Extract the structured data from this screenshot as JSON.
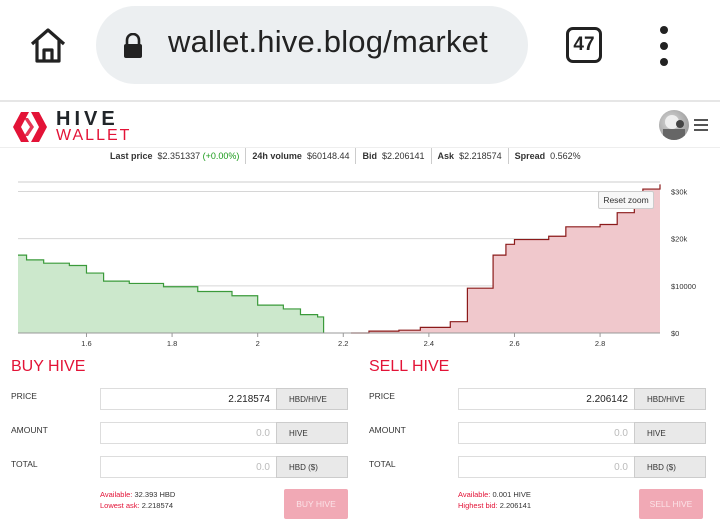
{
  "browser": {
    "url": "wallet.hive.blog/market",
    "tab_count": "47",
    "icons": {
      "home": "home-icon",
      "lock": "lock-icon",
      "menu": "kebab-menu-icon"
    }
  },
  "site": {
    "brand_top": "HIVE",
    "brand_bottom": "WALLET",
    "accent_color": "#e31337"
  },
  "ticker": {
    "last_price_label": "Last price",
    "last_price_value": "$2.351337",
    "last_price_change": "(+0.00%)",
    "volume_label": "24h volume",
    "volume_value": "$60148.44",
    "bid_label": "Bid",
    "bid_value": "$2.206141",
    "ask_label": "Ask",
    "ask_value": "$2.218574",
    "spread_label": "Spread",
    "spread_value": "0.562%"
  },
  "chart_data": {
    "type": "area",
    "reset_zoom_label": "Reset zoom",
    "xlim": [
      1.44,
      2.94
    ],
    "ylim": [
      0,
      32000
    ],
    "x_ticks": [
      "1.6",
      "1.8",
      "2",
      "2.2",
      "2.4",
      "2.6",
      "2.8"
    ],
    "y_ticks": [
      "$0",
      "$10000",
      "$20k",
      "$30k"
    ],
    "grid": true,
    "series": [
      {
        "color": "#3a9a3a",
        "fill": "#cce8cc",
        "points": [
          [
            1.44,
            16500
          ],
          [
            1.46,
            15500
          ],
          [
            1.5,
            14800
          ],
          [
            1.56,
            14300
          ],
          [
            1.6,
            12700
          ],
          [
            1.64,
            11000
          ],
          [
            1.7,
            10500
          ],
          [
            1.78,
            9800
          ],
          [
            1.86,
            8800
          ],
          [
            1.94,
            7900
          ],
          [
            2.0,
            5900
          ],
          [
            2.06,
            5100
          ],
          [
            2.1,
            3900
          ],
          [
            2.14,
            3400
          ],
          [
            2.154,
            0
          ]
        ]
      },
      {
        "color": "#8b1a1a",
        "fill": "#f0c8cc",
        "points": [
          [
            2.218,
            0
          ],
          [
            2.26,
            400
          ],
          [
            2.33,
            600
          ],
          [
            2.38,
            1200
          ],
          [
            2.45,
            2400
          ],
          [
            2.49,
            9500
          ],
          [
            2.55,
            16500
          ],
          [
            2.58,
            18800
          ],
          [
            2.6,
            19800
          ],
          [
            2.68,
            20500
          ],
          [
            2.72,
            22500
          ],
          [
            2.8,
            23000
          ],
          [
            2.84,
            25500
          ],
          [
            2.88,
            26600
          ],
          [
            2.9,
            30500
          ],
          [
            2.94,
            31500
          ]
        ]
      }
    ]
  },
  "buy": {
    "title": "BUY HIVE",
    "price_label": "PRICE",
    "price_value": "2.218574",
    "price_unit": "HBD/HIVE",
    "amount_label": "AMOUNT",
    "amount_placeholder": "0.0",
    "amount_unit": "HIVE",
    "total_label": "TOTAL",
    "total_placeholder": "0.0",
    "total_unit": "HBD ($)",
    "available_label": "Available:",
    "available_value": "32.393 HBD",
    "lowest_ask_label": "Lowest ask:",
    "lowest_ask_value": "2.218574",
    "button_label": "BUY HIVE"
  },
  "sell": {
    "title": "SELL HIVE",
    "price_label": "PRICE",
    "price_value": "2.206142",
    "price_unit": "HBD/HIVE",
    "amount_label": "AMOUNT",
    "amount_placeholder": "0.0",
    "amount_unit": "HIVE",
    "total_label": "TOTAL",
    "total_placeholder": "0.0",
    "total_unit": "HBD ($)",
    "available_label": "Available:",
    "available_value": "0.001 HIVE",
    "highest_bid_label": "Highest bid:",
    "highest_bid_value": "2.206141",
    "button_label": "SELL HIVE"
  }
}
